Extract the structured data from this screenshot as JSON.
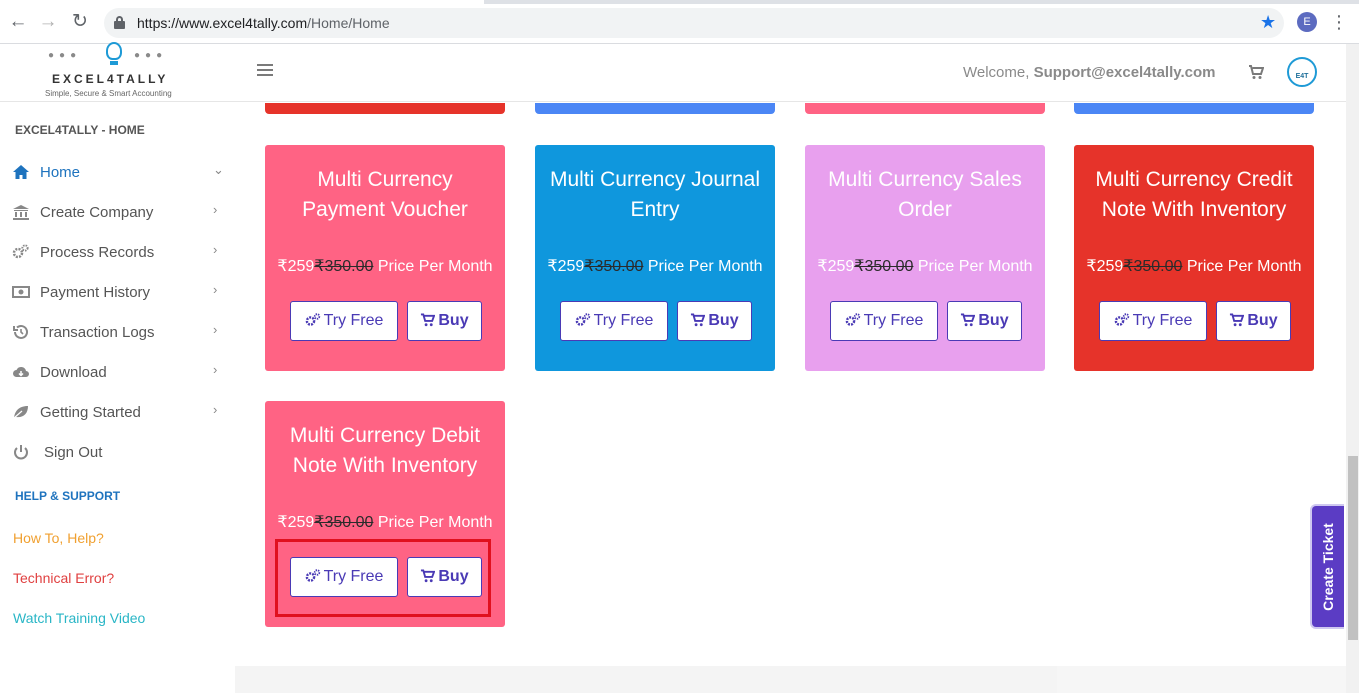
{
  "browser": {
    "url_host": "https://www.excel4tally.com",
    "url_path": "/Home/Home",
    "profile_initial": "E"
  },
  "header": {
    "logo_brand": "EXCEL4TALLY",
    "logo_tagline": "Simple, Secure & Smart Accounting",
    "welcome_label": "Welcome, ",
    "user_email": "Support@excel4tally.com",
    "avatar_text": "E4T"
  },
  "sidebar": {
    "section_title": "EXCEL4TALLY - HOME",
    "items": [
      {
        "label": "Home",
        "icon": "home-icon"
      },
      {
        "label": "Create Company",
        "icon": "bank-icon"
      },
      {
        "label": "Process Records",
        "icon": "cogs-icon"
      },
      {
        "label": "Payment History",
        "icon": "money-icon"
      },
      {
        "label": "Transaction Logs",
        "icon": "history-icon"
      },
      {
        "label": "Download",
        "icon": "cloud-download-icon"
      },
      {
        "label": "Getting Started",
        "icon": "leaf-icon"
      },
      {
        "label": "Sign Out",
        "icon": "power-icon"
      }
    ],
    "help_title": "HELP & SUPPORT",
    "help_links": [
      {
        "label": "How To, Help?",
        "color": "#f0a030"
      },
      {
        "label": "Technical Error?",
        "color": "#e04040"
      },
      {
        "label": "Watch Training Video",
        "color": "#29b6c6"
      }
    ]
  },
  "cards": [
    {
      "title": "Multi Currency Payment Voucher",
      "price_current": "₹259",
      "price_old": "₹350.00",
      "price_suffix": " Price Per Month",
      "color": "#ff6384"
    },
    {
      "title": "Multi Currency Journal Entry",
      "price_current": "₹259",
      "price_old": "₹350.00",
      "price_suffix": " Price Per Month",
      "color": "#0f97dd"
    },
    {
      "title": "Multi Currency Sales Order",
      "price_current": "₹259",
      "price_old": "₹350.00",
      "price_suffix": " Price Per Month",
      "color": "#e8a0ee"
    },
    {
      "title": "Multi Currency Credit Note With Inventory",
      "price_current": "₹259",
      "price_old": "₹350.00",
      "price_suffix": " Price Per Month",
      "color": "#e6332a"
    },
    {
      "title": "Multi Currency Debit Note With Inventory",
      "price_current": "₹259",
      "price_old": "₹350.00",
      "price_suffix": " Price Per Month",
      "color": "#ff6384"
    }
  ],
  "buttons": {
    "try_label": "Try Free",
    "buy_label": "Buy"
  },
  "stub_colors": [
    "#e6332a",
    "#4b86f5",
    "#ff6384",
    "#4b86f5"
  ],
  "create_ticket_label": "Create Ticket"
}
